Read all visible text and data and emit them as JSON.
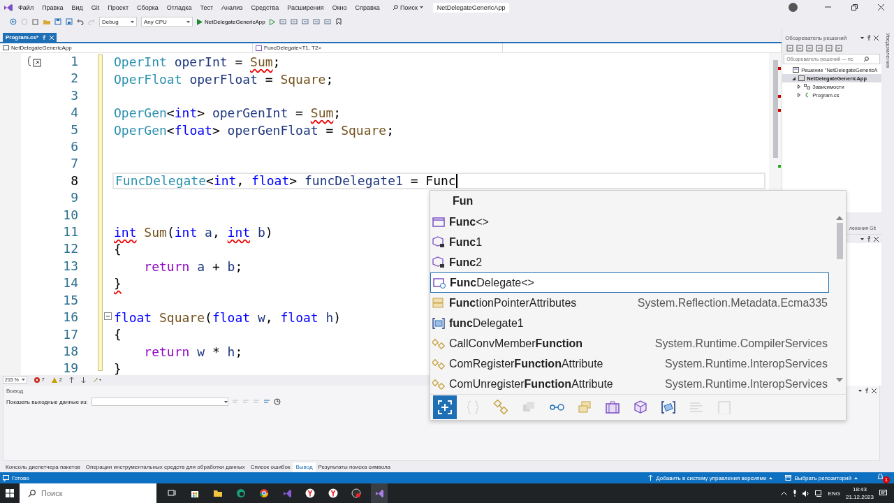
{
  "title_bar": {
    "menu": [
      "Файл",
      "Правка",
      "Вид",
      "Git",
      "Проект",
      "Сборка",
      "Отладка",
      "Тест",
      "Анализ",
      "Средства",
      "Расширения",
      "Окно",
      "Справка"
    ],
    "search": "Поиск",
    "solution_name": "NetDelegateGenericApp"
  },
  "toolbar": {
    "configuration": "Debug",
    "platform": "Any CPU",
    "run_target": "NetDelegateGenericApp"
  },
  "editor": {
    "tabs": [
      {
        "label": "Program.cs*",
        "selected": true
      }
    ],
    "nav": {
      "project": "NetDelegateGenericApp",
      "member": "FuncDelegate<T1, T2>"
    },
    "lines": [
      {
        "number": "1",
        "current": false,
        "foldable": false,
        "tokens": [
          {
            "text": "OperInt",
            "kind": "type",
            "error": false
          },
          {
            "text": " operInt",
            "kind": "local",
            "error": false
          },
          {
            "text": " = ",
            "kind": "plain",
            "error": false
          },
          {
            "text": "Sum",
            "kind": "method",
            "error": true
          },
          {
            "text": ";",
            "kind": "plain",
            "error": false
          }
        ]
      },
      {
        "number": "2",
        "current": false,
        "foldable": false,
        "tokens": [
          {
            "text": "OperFloat",
            "kind": "type",
            "error": false
          },
          {
            "text": " operFloat",
            "kind": "local",
            "error": false
          },
          {
            "text": " = ",
            "kind": "plain",
            "error": false
          },
          {
            "text": "Square",
            "kind": "method",
            "error": false
          },
          {
            "text": ";",
            "kind": "plain",
            "error": false
          }
        ]
      },
      {
        "number": "3",
        "current": false,
        "foldable": false
      },
      {
        "number": "4",
        "current": false,
        "foldable": false,
        "tokens": [
          {
            "text": "OperGen",
            "kind": "type",
            "error": false
          },
          {
            "text": "<",
            "kind": "plain",
            "error": false
          },
          {
            "text": "int",
            "kind": "keyword",
            "error": false
          },
          {
            "text": ">",
            "kind": "plain",
            "error": false
          },
          {
            "text": " operGenInt",
            "kind": "local",
            "error": false
          },
          {
            "text": " = ",
            "kind": "plain",
            "error": false
          },
          {
            "text": "Sum",
            "kind": "method",
            "error": true
          },
          {
            "text": ";",
            "kind": "plain",
            "error": false
          }
        ]
      },
      {
        "number": "5",
        "current": false,
        "foldable": false,
        "tokens": [
          {
            "text": "OperGen",
            "kind": "type",
            "error": false
          },
          {
            "text": "<",
            "kind": "plain",
            "error": false
          },
          {
            "text": "float",
            "kind": "keyword",
            "error": false
          },
          {
            "text": ">",
            "kind": "plain",
            "error": false
          },
          {
            "text": " operGenFloat",
            "kind": "local",
            "error": false
          },
          {
            "text": " = ",
            "kind": "plain",
            "error": false
          },
          {
            "text": "Square",
            "kind": "method",
            "error": false
          },
          {
            "text": ";",
            "kind": "plain",
            "error": false
          }
        ]
      },
      {
        "number": "6",
        "current": false,
        "foldable": false
      },
      {
        "number": "7",
        "current": false,
        "foldable": false
      },
      {
        "number": "8",
        "current": true,
        "foldable": false,
        "tokens": [
          {
            "text": "FuncDelegate",
            "kind": "type",
            "error": false
          },
          {
            "text": "<",
            "kind": "plain",
            "error": false
          },
          {
            "text": "int",
            "kind": "keyword",
            "error": false
          },
          {
            "text": ", ",
            "kind": "plain",
            "error": false
          },
          {
            "text": "float",
            "kind": "keyword",
            "error": false
          },
          {
            "text": ">",
            "kind": "plain",
            "error": false
          },
          {
            "text": " funcDelegate1",
            "kind": "local",
            "error": false
          },
          {
            "text": " = Func",
            "kind": "plain",
            "error": false
          }
        ]
      },
      {
        "number": "9",
        "current": false,
        "foldable": false
      },
      {
        "number": "10",
        "current": false,
        "foldable": false
      },
      {
        "number": "11",
        "current": false,
        "foldable": false,
        "tokens": [
          {
            "text": "int",
            "kind": "keyword",
            "error": true
          },
          {
            "text": " Sum",
            "kind": "method",
            "error": false
          },
          {
            "text": "(",
            "kind": "plain",
            "error": false
          },
          {
            "text": "int",
            "kind": "keyword",
            "error": false
          },
          {
            "text": " a",
            "kind": "param",
            "error": false
          },
          {
            "text": ", ",
            "kind": "plain",
            "error": false
          },
          {
            "text": "int",
            "kind": "keyword",
            "error": true
          },
          {
            "text": " b",
            "kind": "param",
            "error": false
          },
          {
            "text": ")",
            "kind": "plain",
            "error": false
          }
        ]
      },
      {
        "number": "12",
        "current": false,
        "foldable": false,
        "tokens": [
          {
            "text": "{",
            "kind": "plain",
            "error": false
          }
        ]
      },
      {
        "number": "13",
        "current": false,
        "foldable": false,
        "tokens": [
          {
            "text": "    return",
            "kind": "control",
            "error": false
          },
          {
            "text": " a",
            "kind": "param",
            "error": false
          },
          {
            "text": " + ",
            "kind": "plain",
            "error": false
          },
          {
            "text": "b",
            "kind": "param",
            "error": false
          },
          {
            "text": ";",
            "kind": "plain",
            "error": false
          }
        ]
      },
      {
        "number": "14",
        "current": false,
        "foldable": false,
        "tokens": [
          {
            "text": "}",
            "kind": "plain",
            "error": true
          }
        ]
      },
      {
        "number": "15",
        "current": false,
        "foldable": false
      },
      {
        "number": "16",
        "current": false,
        "foldable": true,
        "tokens": [
          {
            "text": "float",
            "kind": "keyword",
            "error": false
          },
          {
            "text": " Square",
            "kind": "method",
            "error": false
          },
          {
            "text": "(",
            "kind": "plain",
            "error": false
          },
          {
            "text": "float",
            "kind": "keyword",
            "error": false
          },
          {
            "text": " w",
            "kind": "param",
            "error": false
          },
          {
            "text": ", ",
            "kind": "plain",
            "error": false
          },
          {
            "text": "float",
            "kind": "keyword",
            "error": false
          },
          {
            "text": " h",
            "kind": "param",
            "error": false
          },
          {
            "text": ")",
            "kind": "plain",
            "error": false
          }
        ]
      },
      {
        "number": "17",
        "current": false,
        "foldable": false,
        "tokens": [
          {
            "text": "{",
            "kind": "plain",
            "error": false
          }
        ]
      },
      {
        "number": "18",
        "current": false,
        "foldable": false,
        "tokens": [
          {
            "text": "    return",
            "kind": "control",
            "error": false
          },
          {
            "text": " w",
            "kind": "param",
            "error": false
          },
          {
            "text": " * ",
            "kind": "plain",
            "error": false
          },
          {
            "text": "h",
            "kind": "param",
            "error": false
          },
          {
            "text": ";",
            "kind": "plain",
            "error": false
          }
        ]
      },
      {
        "number": "19",
        "current": false,
        "foldable": false,
        "tokens": [
          {
            "text": "}",
            "kind": "plain",
            "error": false
          }
        ]
      }
    ],
    "zoom": "215 %",
    "errors": "7",
    "warnings": "2"
  },
  "completion": {
    "items": [
      {
        "kind": "typed",
        "label": "Fun",
        "selected": false
      },
      {
        "kind": "delegate",
        "label": "**Func**<>",
        "selected": false
      },
      {
        "kind": "locked-class",
        "label": "**Func**1",
        "selected": false
      },
      {
        "kind": "locked-class",
        "label": "**Func**2",
        "selected": false
      },
      {
        "kind": "user-delegate",
        "label": "**Func**Delegate<>",
        "selected": true
      },
      {
        "kind": "class",
        "label": "**Func**tionPointerAttributes",
        "namespace": "System.Reflection.Metadata.Ecma335",
        "selected": false
      },
      {
        "kind": "local",
        "label": "**func**Delegate1",
        "selected": false
      },
      {
        "kind": "extension",
        "label": "CallConvMember**Function**",
        "namespace": "System.Runtime.CompilerServices",
        "selected": false
      },
      {
        "kind": "extension",
        "label": "ComRegister**Function**Attribute",
        "namespace": "System.Runtime.InteropServices",
        "selected": false
      },
      {
        "kind": "extension",
        "label": "ComUnregister**Function**Attribute",
        "namespace": "System.Runtime.InteropServices",
        "selected": false
      }
    ],
    "filters": [
      {
        "kind": "expand",
        "selected": true,
        "disabled": false
      },
      {
        "kind": "namespace",
        "selected": false,
        "disabled": true
      },
      {
        "kind": "extension",
        "selected": false,
        "disabled": false
      },
      {
        "kind": "stack",
        "selected": false,
        "disabled": true
      },
      {
        "kind": "connector",
        "selected": false,
        "disabled": false
      },
      {
        "kind": "cards",
        "selected": false,
        "disabled": false
      },
      {
        "kind": "briefcase",
        "selected": false,
        "disabled": false
      },
      {
        "kind": "cube",
        "selected": false,
        "disabled": false
      },
      {
        "kind": "bracket",
        "selected": false,
        "disabled": false
      },
      {
        "kind": "lines",
        "selected": false,
        "disabled": true
      },
      {
        "kind": "frame",
        "selected": false,
        "disabled": true
      }
    ]
  },
  "explorer": {
    "title": "Обозреватель решений",
    "search_placeholder": "Обозреватель решений — пс",
    "tree": [
      {
        "kind": "solution",
        "label": "Решение \"NetDelegateGenericA",
        "selected": false,
        "children": [
          {
            "kind": "project",
            "label": "NetDelegateGenericApp",
            "selected": true,
            "expanded": true,
            "children": [
              {
                "kind": "dependencies",
                "label": "Зависимости",
                "selected": false,
                "expanded": false
              },
              {
                "kind": "csharp",
                "label": "Program.cs",
                "selected": false,
                "expanded": false
              }
            ]
          }
        ]
      }
    ]
  },
  "git_tab": "ленения Git",
  "notifications_strip": "Уведомления",
  "output": {
    "title": "Вывод",
    "source_label": "Показать выходные данные из:"
  },
  "bottom_tabs": [
    {
      "label": "Консоль диспетчера пакетов",
      "selected": false
    },
    {
      "label": "Операции инструментальных средств для обработки данных",
      "selected": false
    },
    {
      "label": "Список ошибок",
      "selected": false
    },
    {
      "label": "Вывод",
      "selected": true
    },
    {
      "label": "Результаты поиска символа",
      "selected": false
    }
  ],
  "status_bar": {
    "text": "Готово",
    "source_control": "Добавить в систему управления версиями",
    "repository": "Выбрать репозиторий",
    "notifications": "1"
  },
  "taskbar": {
    "search_placeholder": "Поиск",
    "language": "ENG",
    "time": "18:43",
    "date": "21.12.2023"
  }
}
